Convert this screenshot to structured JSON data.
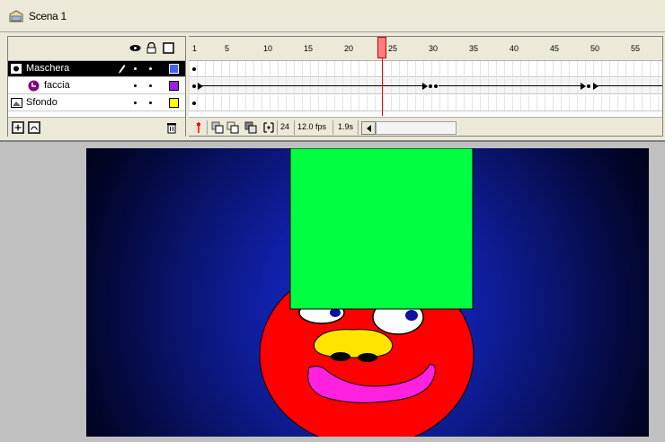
{
  "scene": {
    "label": "Scena 1",
    "icon": "scene-icon"
  },
  "header_icons": [
    "eye-icon",
    "lock-icon",
    "outline-icon"
  ],
  "layers": [
    {
      "name": "Maschera",
      "type": "mask-layer-icon",
      "selected": true,
      "color": "#4060ff"
    },
    {
      "name": "faccia",
      "type": "masked-layer-icon",
      "selected": false,
      "color": "#a020e0"
    },
    {
      "name": "Sfondo",
      "type": "layer-icon",
      "selected": false,
      "color": "#ffff00"
    }
  ],
  "ruler": {
    "labels": [
      "1",
      "5",
      "10",
      "15",
      "20",
      "25",
      "30",
      "35",
      "40",
      "45",
      "50",
      "55"
    ]
  },
  "frames_footer": {
    "current_frame": "24",
    "frame_rate": "12.0 fps",
    "elapsed": "1.9s"
  },
  "colors": {
    "face": "#ff0000",
    "mask_square": "#00ff40",
    "mouth": "#ff20e0",
    "nose": "#ffe400"
  }
}
